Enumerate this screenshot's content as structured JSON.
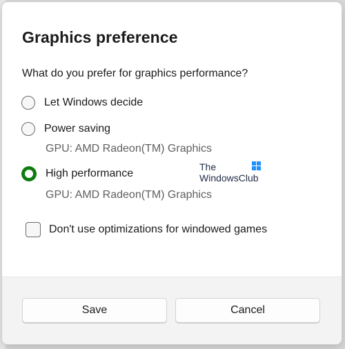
{
  "dialog": {
    "title": "Graphics preference",
    "question": "What do you prefer for graphics performance?",
    "options": [
      {
        "label": "Let Windows decide",
        "selected": false
      },
      {
        "label": "Power saving",
        "selected": false,
        "gpu": "GPU: AMD Radeon(TM) Graphics"
      },
      {
        "label": "High performance",
        "selected": true,
        "gpu": "GPU: AMD Radeon(TM) Graphics"
      }
    ],
    "checkbox": {
      "label": "Don't use optimizations for windowed games",
      "checked": false
    },
    "buttons": {
      "save": "Save",
      "cancel": "Cancel"
    }
  },
  "watermark": {
    "line1": "The",
    "line2": "WindowsClub"
  },
  "colors": {
    "accent": "#0f7b0f",
    "logo": "#1e90ff"
  }
}
